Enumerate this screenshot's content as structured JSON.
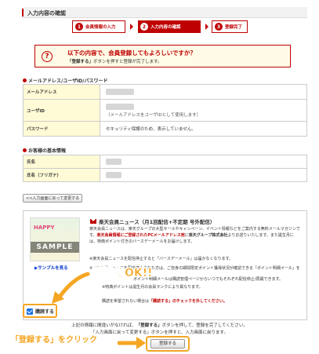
{
  "header": {
    "title": "入力内容の確認"
  },
  "steps": [
    {
      "num": "1",
      "label": "会員情報の入力"
    },
    {
      "num": "2",
      "label": "入力内容の確認"
    },
    {
      "num": "3",
      "label": "登録完了"
    }
  ],
  "notice": {
    "line1": "以下の内容で、会員登録してもよろしいですか？",
    "line2_strong": "「登録する」",
    "line2_rest": "ボタンを押すと登録が完了します。"
  },
  "section_email": {
    "title": "メールアドレス/ユーザID/パスワード",
    "rows": [
      {
        "label": "メールアドレス",
        "value": ""
      },
      {
        "label": "ユーザID",
        "value": "",
        "note": "（メールアドレスをユーザIDとして使用します）"
      },
      {
        "label": "パスワード",
        "value": "セキュリティ保護のため、表示していません。"
      }
    ]
  },
  "section_basic": {
    "title": "お客様の基本情報",
    "rows": [
      {
        "label": "氏名",
        "value": ""
      },
      {
        "label": "氏名（フリガナ）",
        "value": ""
      }
    ]
  },
  "back_button": "<<入力画面に戻って変更する",
  "news": {
    "image_happy": "HAPPY",
    "image_sample": "SAMPLE",
    "sample_link": "▶サンプルを見る",
    "title": "楽天会員ニュース（月1回配信+不定期 号外配信）",
    "p1_a": "楽天会員ニュースは、楽天グループの大型セールやキャンペーン、イベント情報などをご案内する無料メールマガジンです。",
    "p1_red": "楽天会員情報にご登録されたPCメールアドレス宛",
    "p1_b": "に",
    "p1_bold": "楽天グループ株式会社",
    "p1_c": "よりお送りいたします。また誕生月には、特典ポイント付きのバースデーメールをお届けします。",
    "p2": "※楽天会員ニュースを配信停止すると「バースデーメール」は届かなくなります。",
    "p3": "※楽天会員ニュースを配信停止された方は、ご自身の期間限定ポイント獲得状況が確認できる「ポイント明細メール」を",
    "p4": "ポイント明細メールは購読管理ページからいつでもそれぞれ配信停止/再開できます。",
    "p5": "※特典ポイントは誕生月の会員ランクにより異なります。",
    "p6_a": "購読を希望されない場合は",
    "p6_red": "「購読する」のチェックを外してください。"
  },
  "subscribe": {
    "label": "購読する",
    "checked": true
  },
  "bottom": {
    "line1_a": "上記の情報に間違いがなければ、",
    "line1_b": "「登録する」",
    "line1_c": "ボタンを押して、登録を完了してください。",
    "line2": "「入力画面に戻って変更する」ボタンを押すと、入力画面に戻ります。"
  },
  "submit_button": "登録する",
  "annotations": {
    "callout1": "解除でOK!!",
    "callout2": "「登録する」をクリック"
  },
  "colors": {
    "brand_red": "#bf0000",
    "highlight_orange": "#f5a623",
    "label_bg": "#fffbd6",
    "notice_bg": "#fffbe6"
  }
}
